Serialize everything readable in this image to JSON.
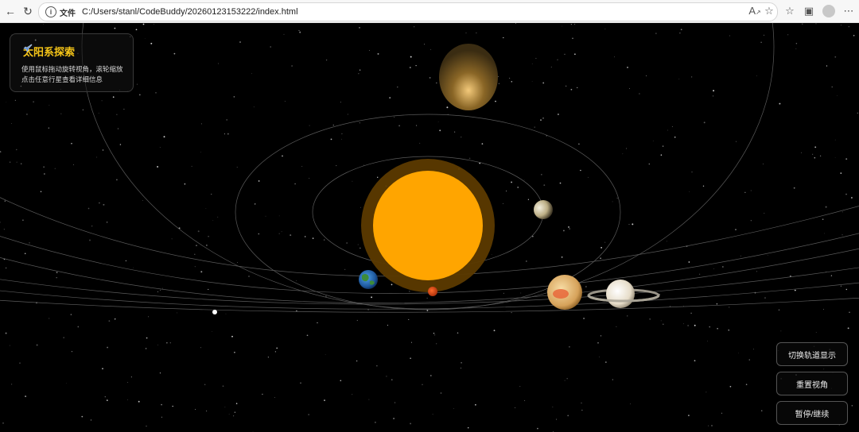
{
  "browser": {
    "scheme_label": "文件",
    "url": "C:/Users/stanl/CodeBuddy/20260123153222/index.html"
  },
  "info_panel": {
    "title": "太阳系探索",
    "line1": "使用鼠标拖动旋转视角，滚轮缩放",
    "line2": "点击任意行星查看详细信息",
    "icon": "rocket-icon"
  },
  "controls": {
    "toggle_orbits": "切换轨道显示",
    "reset_view": "重置视角",
    "pause_resume": "暂停/继续"
  },
  "colors": {
    "sun": "#ffa500",
    "sun_glow": "#6b4300",
    "accent_title": "#f5c518",
    "orbit": "#555555"
  },
  "planets": [
    "sun",
    "mercury",
    "venus",
    "earth",
    "mars",
    "jupiter",
    "saturn",
    "uranus",
    "neptune"
  ]
}
